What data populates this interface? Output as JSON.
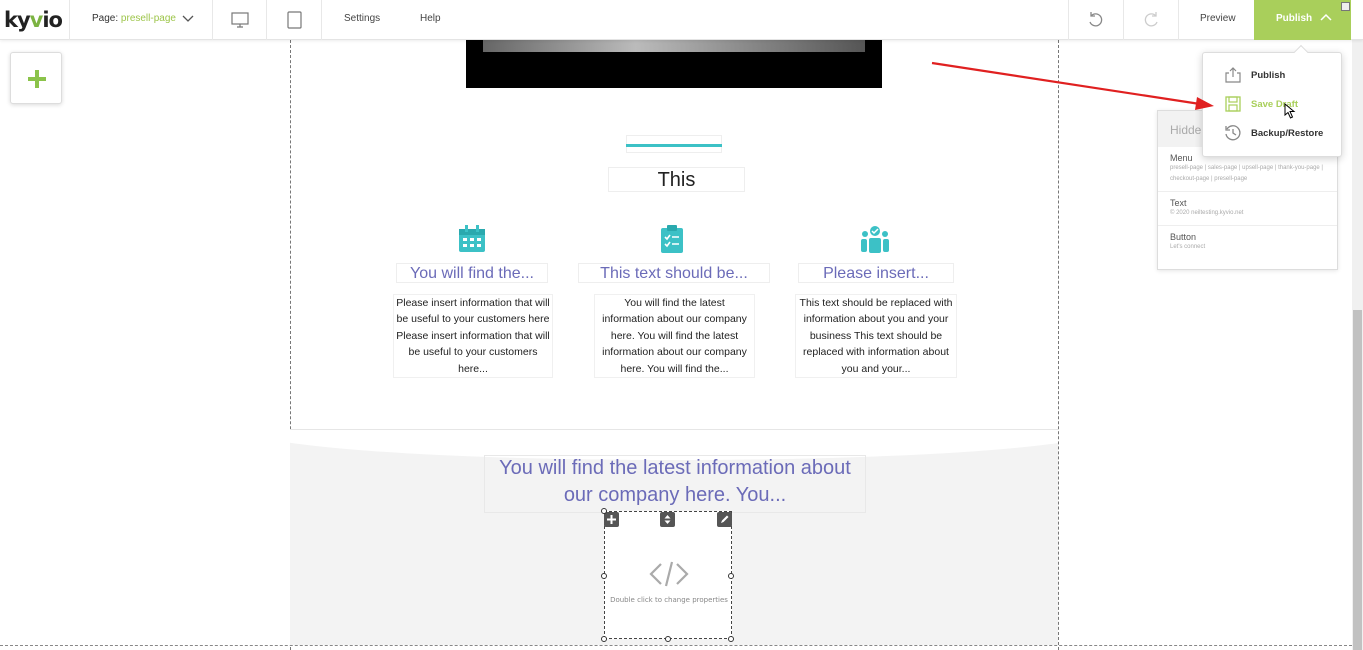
{
  "app": {
    "logo_text_pre": "ky",
    "logo_text_v": "v",
    "logo_text_post": "io"
  },
  "topbar": {
    "page_label": "Page: ",
    "page_value": "presell-page",
    "settings_label": "Settings",
    "help_label": "Help",
    "preview_label": "Preview",
    "publish_label": "Publish"
  },
  "publish_menu": {
    "items": [
      {
        "label": "Publish",
        "icon": "upload-icon"
      },
      {
        "label": "Save Draft",
        "icon": "save-icon"
      },
      {
        "label": "Backup/Restore",
        "icon": "history-icon"
      }
    ]
  },
  "hidden_panel": {
    "header": "Hidde",
    "items": [
      {
        "title": "Menu",
        "sub": "presell-page | sales-page | upsell-page | thank-you-page | checkout-page | presell-page"
      },
      {
        "title": "Text",
        "sub": "© 2020 neiltesting.kyvio.net"
      },
      {
        "title": "Button",
        "sub": "Let's connect"
      }
    ]
  },
  "content": {
    "section_title": "This",
    "features": [
      {
        "icon": "calendar-icon",
        "heading": "You will find the...",
        "text": "Please insert information that will be useful to your customers here Please insert information that will be useful to your customers here..."
      },
      {
        "icon": "clipboard-check-icon",
        "heading": "This text should be...",
        "text": "You will find the latest information about our company here. You will find the latest information about our company here. You will find the..."
      },
      {
        "icon": "team-icon",
        "heading": "Please insert...",
        "text": "This text should be replaced with information about you and your business This text should be replaced with information about you and your..."
      }
    ],
    "big_text": "You will find the latest information about our company here. You...",
    "code_hint": "Double click to change properties"
  },
  "colors": {
    "accent_green": "#a9cf5b",
    "teal": "#3cc1c6",
    "heading_purple": "#6b6bb8",
    "arrow_red": "#e02020"
  }
}
